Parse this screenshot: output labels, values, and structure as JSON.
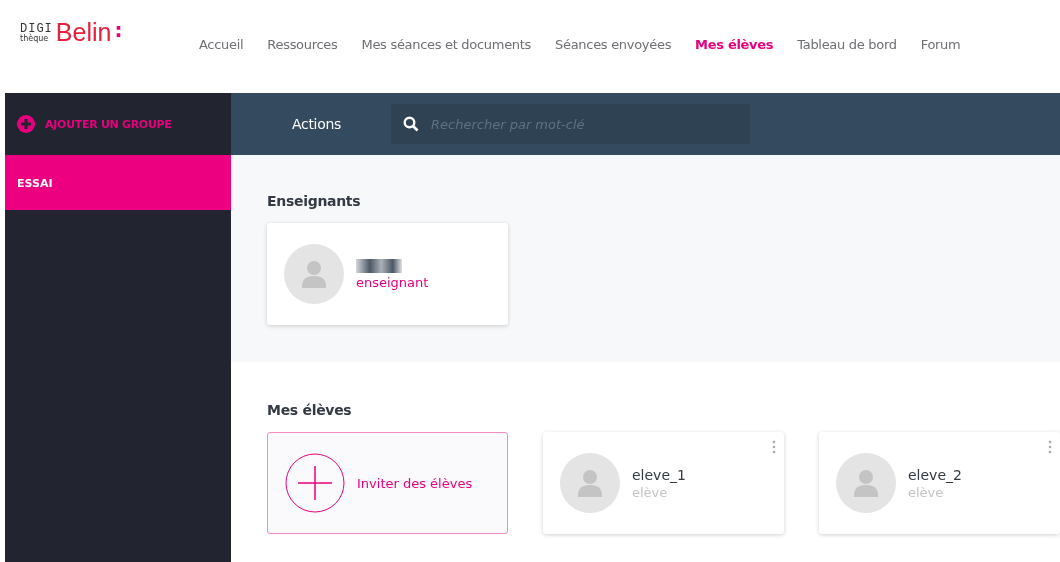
{
  "logo": {
    "top": "DIGI",
    "bottom": "thèque",
    "brand": "Belin",
    "mark": ":"
  },
  "nav": [
    {
      "label": "Accueil",
      "selected": false
    },
    {
      "label": "Ressources",
      "selected": false
    },
    {
      "label": "Mes séances et documents",
      "selected": false
    },
    {
      "label": "Séances envoyées",
      "selected": false
    },
    {
      "label": "Mes élèves",
      "selected": true
    },
    {
      "label": "Tableau de bord",
      "selected": false
    },
    {
      "label": "Forum",
      "selected": false
    }
  ],
  "sidebar": {
    "add_button": "AJOUTER UN GROUPE",
    "groups": [
      {
        "label": "ESSAI",
        "selected": true
      }
    ]
  },
  "toolbar": {
    "actions": "Actions",
    "search": {
      "placeholder": "Rechercher par mot-clé"
    }
  },
  "teachers": {
    "heading": "Enseignants",
    "members": [
      {
        "role": "enseignant",
        "redacted": true
      }
    ]
  },
  "students": {
    "heading": "Mes élèves",
    "invite": "Inviter des élèves",
    "members": [
      {
        "name": "eleve_1",
        "role": "elève"
      },
      {
        "name": "eleve_2",
        "role": "elève"
      }
    ]
  }
}
